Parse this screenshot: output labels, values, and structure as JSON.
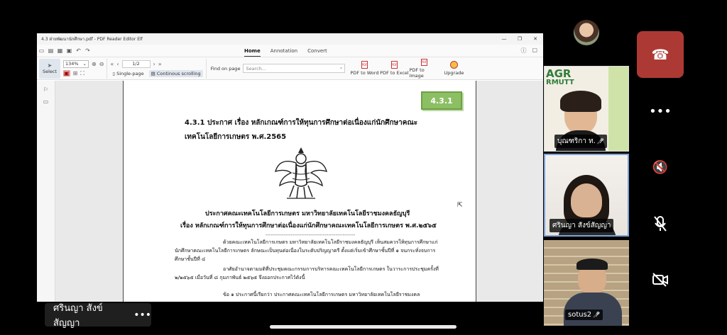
{
  "window": {
    "title": "4.3 ฝ่ายพัฒนานักศึกษา.pdf - PDF Reader Editor Elf",
    "controls": [
      "—",
      "❐",
      "✕"
    ]
  },
  "menu": {
    "tabs": [
      {
        "label": "Home",
        "active": true
      },
      {
        "label": "Annotation",
        "active": false
      },
      {
        "label": "Convert",
        "active": false
      }
    ]
  },
  "ribbon": {
    "select_label": "Select",
    "zoom_value": "134%",
    "page_value": "1/2",
    "single_page_label": "Single-page",
    "continuous_label": "Continous scrolling",
    "find_label": "Find on page",
    "search_placeholder": "Search...",
    "pdf_to_word": "PDF to Word",
    "pdf_to_excel": "PDF to Excel",
    "pdf_to_image": "PDF to Image",
    "upgrade": "Upgrade"
  },
  "document": {
    "badge": "4.3.1",
    "title": "4.3.1 ประกาศ เรื่อง หลักเกณฑ์การให้ทุนการศึกษาต่อเนื่องแก่นักศึกษาคณะเทคโนโลยีการเกษตร พ.ศ.2565",
    "announce_line1": "ประกาศคณะเทคโนโลยีการเกษตร มหาวิทยาลัยเทคโนโลยีราชมงคลธัญบุรี",
    "announce_line2": "เรื่อง หลักเกณฑ์การให้ทุนการศึกษาต่อเนื่องแก่นักศึกษาคณะเทคโนโลยีการเกษตร พ.ศ.๒๕๖๕",
    "separator": "--------------------------------------------------",
    "para1": "ด้วยคณะเทคโนโลยีการเกษตร มหาวิทยาลัยเทคโนโลยีราชมงคลธัญบุรี เห็นสมควรให้ทุนการศึกษาแก่นักศึกษาคณะเทคโนโลยีการเกษตร ลักษณะเป็นทุนต่อเนื่องในระดับปริญญาตรี ตั้งแต่เริ่มเข้าศึกษาชั้นปีที่ ๑ จนกระทั่งจบการศึกษาชั้นปีที่ ๔",
    "para2": "อาศัยอำนาจตามมติที่ประชุมคณะกรรมการบริหารคณะเทคโนโลยีการเกษตร ในวาระการประชุมครั้งที่ ๒/๒๕๖๕ เมื่อวันที่ ๘ กุมภาพันธ์ ๒๕๖๕ จึงออกประกาศไว้ดังนี้",
    "para3": "ข้อ ๑ ประกาศนี้เรียกว่า ประกาศคณะเทคโนโลยีการเกษตร มหาวิทยาลัยเทคโนโลยีราชมงคล"
  },
  "participants": [
    {
      "name": "บุณฑริกา ท.",
      "muted": true
    },
    {
      "name": "ศรินญา  สังข์สัญญา",
      "muted": true
    },
    {
      "name": "sotus2",
      "muted": true
    }
  ],
  "tile1_logo": "AGR",
  "tile1_logo2": "RMUTT",
  "self_name": "ศรินญา  สังข์สัญญา",
  "colors": {
    "leave": "#ad3934",
    "badge": "#8cbf63",
    "active_speaker": "#7ea4d8"
  }
}
